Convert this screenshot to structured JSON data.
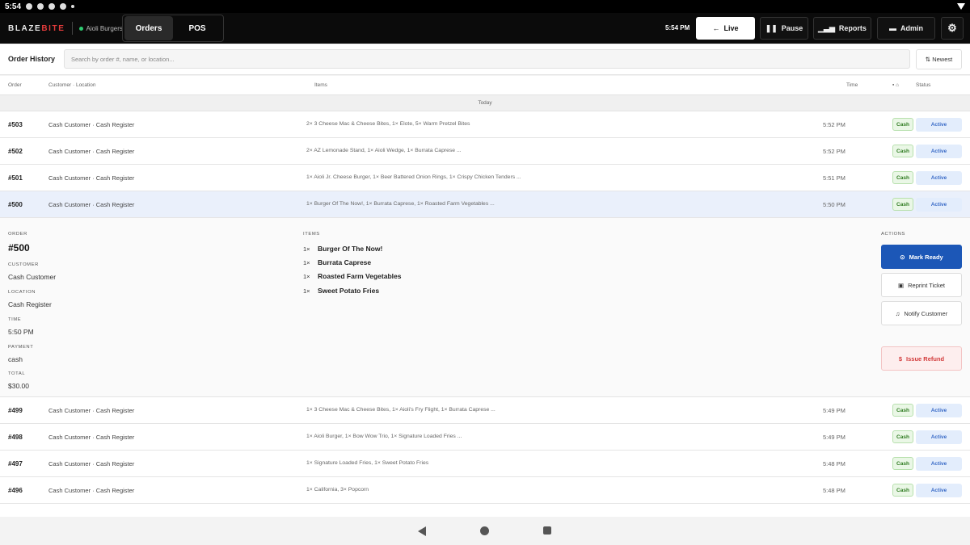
{
  "status_bar": {
    "time": "5:54"
  },
  "topbar": {
    "brand_prefix": "BLAZE",
    "brand_accent": "BITE",
    "venue": "Aioli Burgers",
    "tabs": [
      {
        "label": "Orders"
      },
      {
        "label": "POS"
      }
    ],
    "clock": "5:54 PM",
    "live_label": "Live",
    "pause_label": "Pause",
    "reports_label": "Reports",
    "admin_label": "Admin"
  },
  "toolbar": {
    "title": "Order History",
    "search_placeholder": "Search by order #, name, or location...",
    "sort_label": "Newest"
  },
  "table": {
    "headers": {
      "order": "Order",
      "customer": "Customer · Location",
      "items": "Items",
      "time": "Time",
      "status": "Status"
    },
    "group": "Today",
    "rows_top": [
      {
        "order": "#503",
        "customer": "Cash Customer · Cash Register",
        "items": "2× 3 Cheese Mac & Cheese Bites, 1× Elote, 5× Warm Pretzel Bites",
        "time": "5:52 PM",
        "payment": "Cash",
        "status": "Active"
      },
      {
        "order": "#502",
        "customer": "Cash Customer · Cash Register",
        "items": "2× AZ Lemonade Stand, 1× Aioli Wedge, 1× Burrata Caprese ...",
        "time": "5:52 PM",
        "payment": "Cash",
        "status": "Active"
      },
      {
        "order": "#501",
        "customer": "Cash Customer · Cash Register",
        "items": "1× Aioli Jr. Cheese Burger, 1× Beer Battered Onion Rings, 1× Crispy Chicken Tenders ...",
        "time": "5:51 PM",
        "payment": "Cash",
        "status": "Active"
      },
      {
        "order": "#500",
        "customer": "Cash Customer · Cash Register",
        "items": "1× Burger Of The Now!, 1× Burrata Caprese, 1× Roasted Farm Vegetables ...",
        "time": "5:50 PM",
        "payment": "Cash",
        "status": "Active"
      }
    ],
    "rows_bottom": [
      {
        "order": "#499",
        "customer": "Cash Customer · Cash Register",
        "items": "1× 3 Cheese Mac & Cheese Bites, 1× Aioli's Fry Flight, 1× Burrata Caprese ...",
        "time": "5:49 PM",
        "payment": "Cash",
        "status": "Active"
      },
      {
        "order": "#498",
        "customer": "Cash Customer · Cash Register",
        "items": "1× Aioli Burger, 1× Bow Wow Trio, 1× Signature Loaded Fries ...",
        "time": "5:49 PM",
        "payment": "Cash",
        "status": "Active"
      },
      {
        "order": "#497",
        "customer": "Cash Customer · Cash Register",
        "items": "1× Signature Loaded Fries, 1× Sweet Potato Fries",
        "time": "5:48 PM",
        "payment": "Cash",
        "status": "Active"
      },
      {
        "order": "#496",
        "customer": "Cash Customer · Cash Register",
        "items": "1× California, 3× Popcorn",
        "time": "5:48 PM",
        "payment": "Cash",
        "status": "Active"
      }
    ]
  },
  "details": {
    "order_label": "ORDER",
    "order": "#500",
    "customer_label": "CUSTOMER",
    "customer": "Cash Customer",
    "location_label": "LOCATION",
    "location": "Cash Register",
    "time_label": "TIME",
    "time": "5:50 PM",
    "payment_label": "PAYMENT",
    "payment": "cash",
    "total_label": "TOTAL",
    "total": "$30.00",
    "items_label": "ITEMS",
    "items": [
      {
        "qty": "1×",
        "name": "Burger Of The Now!"
      },
      {
        "qty": "1×",
        "name": "Burrata Caprese"
      },
      {
        "qty": "1×",
        "name": "Roasted Farm Vegetables"
      },
      {
        "qty": "1×",
        "name": "Sweet Potato Fries"
      }
    ],
    "actions_label": "ACTIONS",
    "mark_ready": "Mark Ready",
    "reprint": "Reprint Ticket",
    "notify": "Notify Customer",
    "refund": "Issue Refund"
  }
}
